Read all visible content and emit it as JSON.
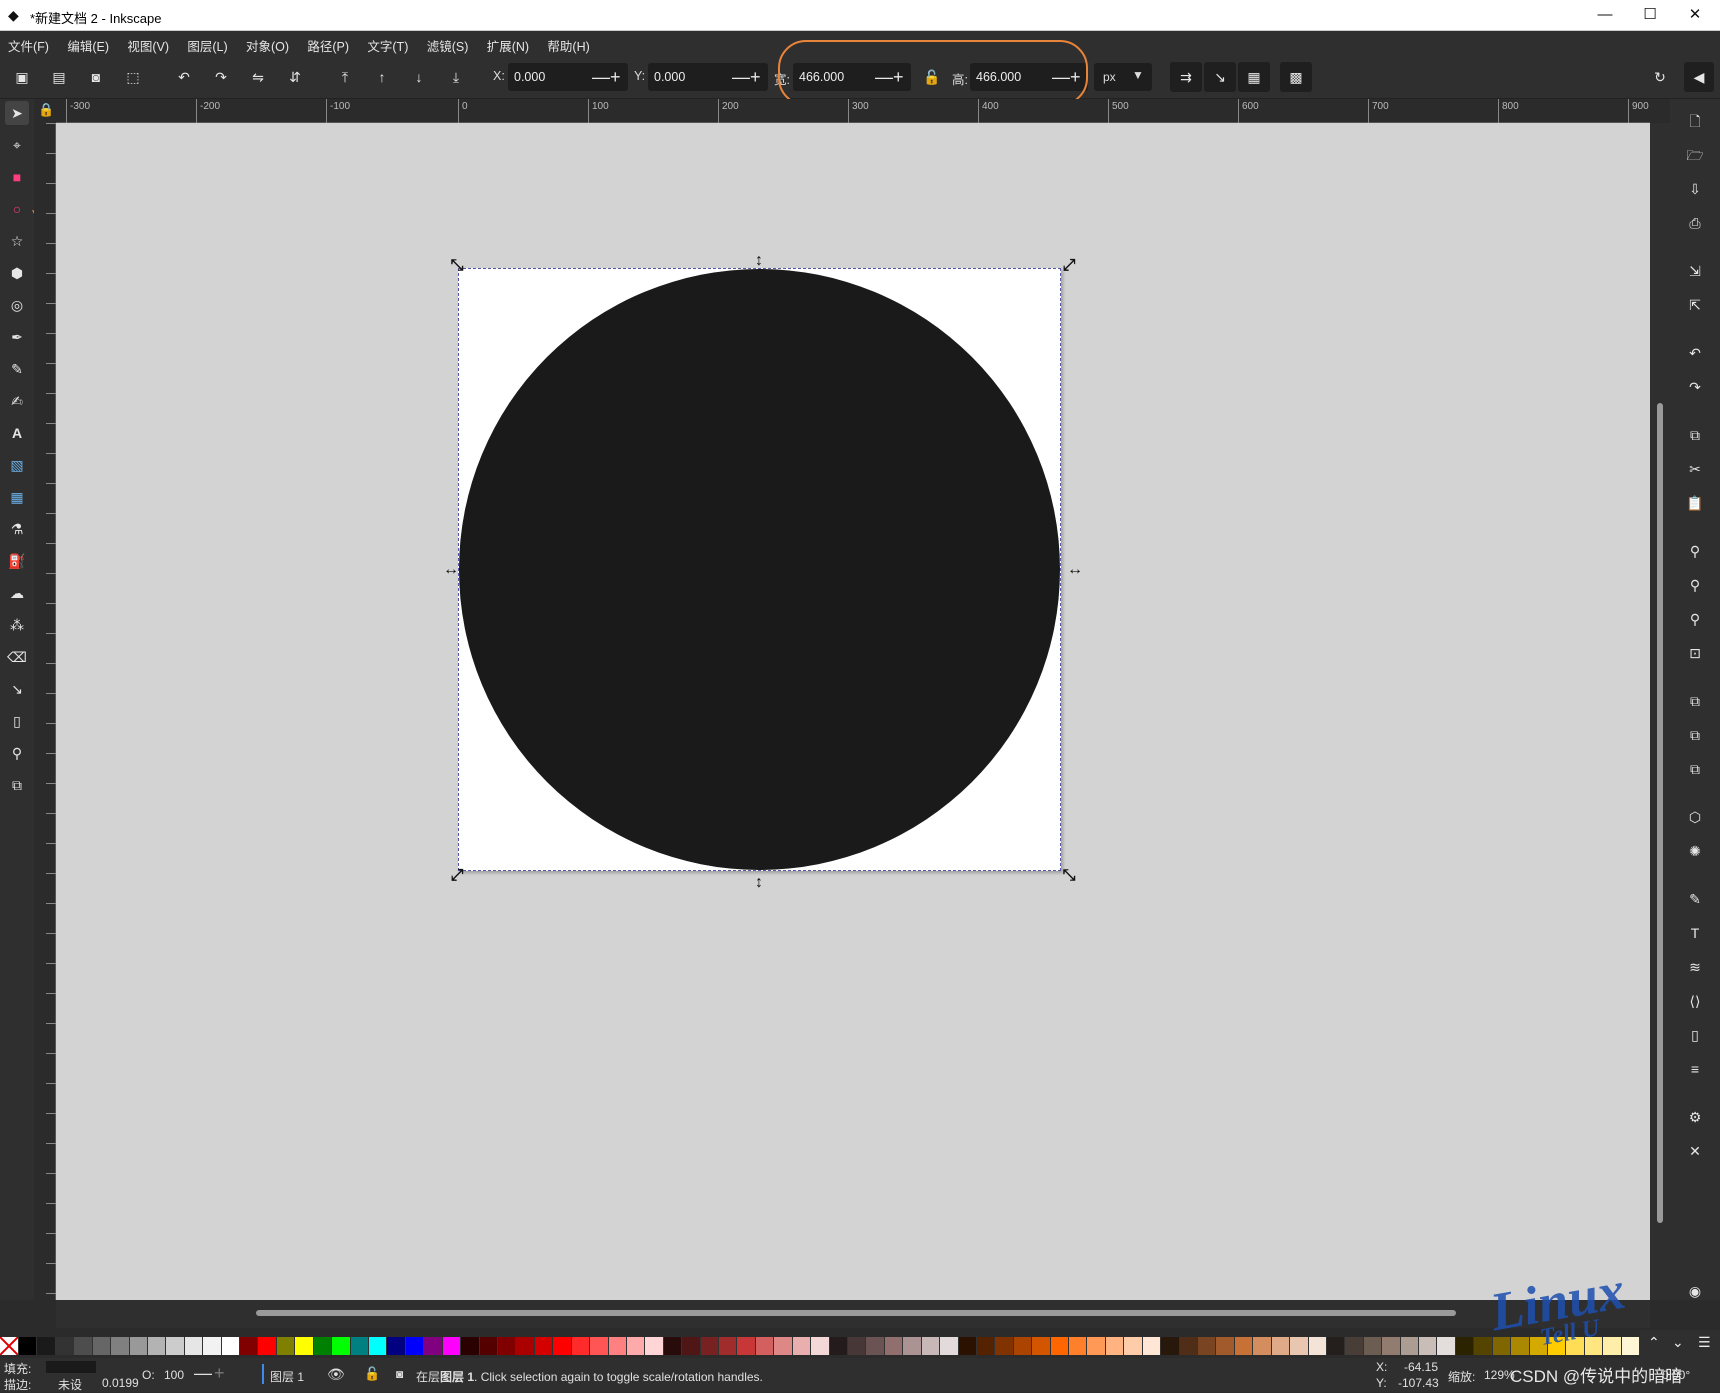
{
  "window": {
    "title": "*新建文档 2 - Inkscape",
    "controls": {
      "minimize": "—",
      "maximize": "☐",
      "close": "✕"
    }
  },
  "menu": [
    "文件(F)",
    "编辑(E)",
    "视图(V)",
    "图层(L)",
    "对象(O)",
    "路径(P)",
    "文字(T)",
    "滤镜(S)",
    "扩展(N)",
    "帮助(H)"
  ],
  "toolbar": {
    "x_label": "X:",
    "x_value": "0.000",
    "y_label": "Y:",
    "y_value": "0.000",
    "w_label": "宽:",
    "w_value": "466.000",
    "h_label": "高:",
    "h_value": "466.000",
    "unit": "px",
    "minus": "—",
    "plus": "+"
  },
  "ruler": {
    "labels": [
      "-300",
      "-200",
      "-100",
      "0",
      "100",
      "200",
      "300",
      "400",
      "500",
      "600",
      "700",
      "800",
      "900"
    ]
  },
  "statusbar": {
    "fill_label": "填充:",
    "stroke_label": "描边:",
    "stroke_value": "未设",
    "stroke_width": "0.0199",
    "opacity_label": "O:",
    "opacity_value": "100",
    "layer": "图层 1",
    "message_prefix": "在层",
    "message_bold": "图层 1",
    "message_suffix": ". Click selection again to toggle scale/rotation handles.",
    "x_label": "X:",
    "x_value": "-64.15",
    "y_label": "Y:",
    "y_value": "-107.43",
    "zoom_label": "缩放:",
    "zoom_value": "129%",
    "rotate_value": "0.00°"
  },
  "watermark": {
    "text1": "Linux",
    "text2": "Tell U",
    "csdn": "CSDN @传说中的暗暗"
  },
  "palette": [
    "#000000",
    "#1a1a1a",
    "#333333",
    "#4d4d4d",
    "#666666",
    "#808080",
    "#999999",
    "#b3b3b3",
    "#cccccc",
    "#e6e6e6",
    "#f2f2f2",
    "#ffffff",
    "#800000",
    "#ff0000",
    "#808000",
    "#ffff00",
    "#008000",
    "#00ff00",
    "#008080",
    "#00ffff",
    "#000080",
    "#0000ff",
    "#800080",
    "#ff00ff",
    "#2b0000",
    "#550000",
    "#800000",
    "#aa0000",
    "#d40000",
    "#ff0000",
    "#ff2a2a",
    "#ff5555",
    "#ff8080",
    "#ffaaaa",
    "#ffd5d5",
    "#280b0b",
    "#501616",
    "#782121",
    "#a02c2c",
    "#c83737",
    "#d35f5f",
    "#de8787",
    "#e9afaf",
    "#f4d7d7",
    "#241c1c",
    "#483737",
    "#6c5353",
    "#916f6f",
    "#ac9393",
    "#c8b7b7",
    "#e3dbdb",
    "#2b1100",
    "#552200",
    "#803300",
    "#aa4400",
    "#d45500",
    "#ff6600",
    "#ff7f2a",
    "#ff9955",
    "#ffb380",
    "#ffccaa",
    "#ffe6d5",
    "#28170b",
    "#502d16",
    "#784421",
    "#a05a2c",
    "#c87137",
    "#d38d5f",
    "#deaa87",
    "#e9c6af",
    "#f4e3d7",
    "#241f1c",
    "#483e37",
    "#6c5d53",
    "#917c6f",
    "#ac9d93",
    "#c8beb7",
    "#e3dedb",
    "#2b2200",
    "#554400",
    "#806600",
    "#aa8800",
    "#d4aa00",
    "#ffcc00",
    "#ffdd55",
    "#ffe680",
    "#ffeeaa",
    "#fff6d5"
  ]
}
